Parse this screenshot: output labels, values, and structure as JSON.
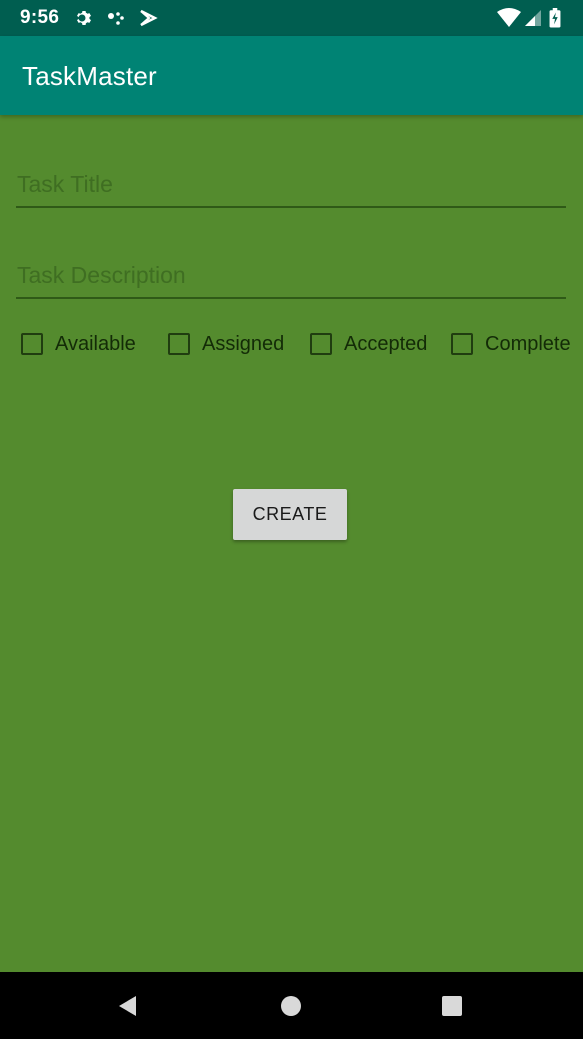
{
  "status_bar": {
    "time": "9:56",
    "left_icons": [
      "settings-icon",
      "dots-icon",
      "play-store-icon"
    ],
    "right_icons": [
      "wifi-icon",
      "signal-icon",
      "battery-icon"
    ]
  },
  "app_bar": {
    "title": "TaskMaster"
  },
  "form": {
    "title_field": {
      "placeholder": "Task Title",
      "value": ""
    },
    "description_field": {
      "placeholder": "Task Description",
      "value": ""
    },
    "statuses": [
      {
        "label": "Available",
        "checked": false
      },
      {
        "label": "Assigned",
        "checked": false
      },
      {
        "label": "Accepted",
        "checked": false
      },
      {
        "label": "Complete",
        "checked": false
      }
    ],
    "create_label": "CREATE"
  },
  "nav_bar": {
    "buttons": [
      "back-icon",
      "home-icon",
      "recents-icon"
    ]
  },
  "colors": {
    "status_bar": "#005e50",
    "app_bar": "#008374",
    "background": "#548b2e",
    "button": "#d6d7d7"
  }
}
